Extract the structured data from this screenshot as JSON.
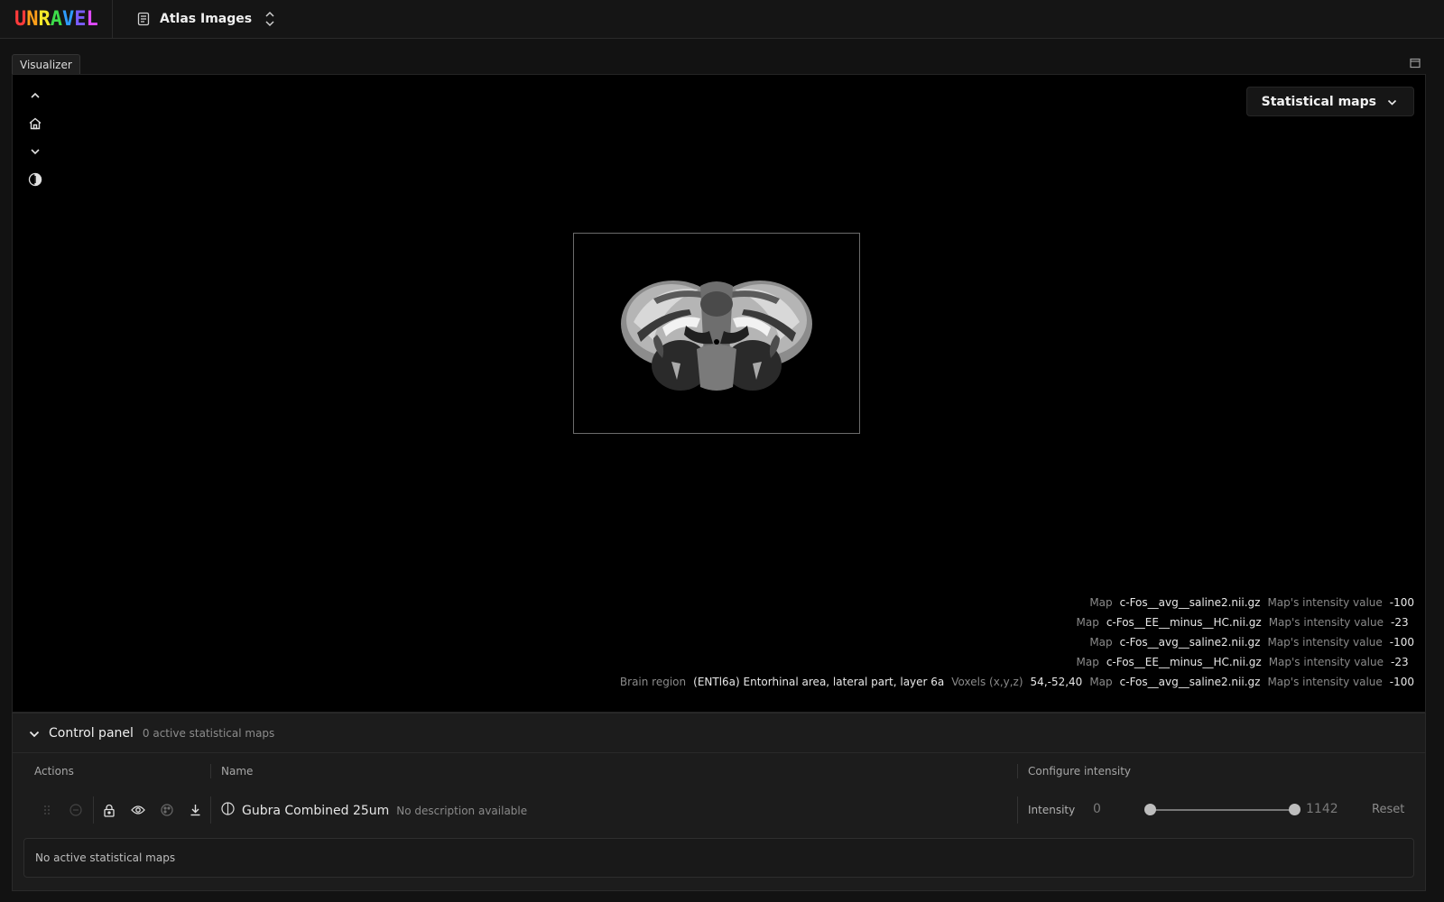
{
  "app": {
    "logo_text": "UNRAVEL",
    "logo_colors": [
      "#ff3b3b",
      "#ff9f1a",
      "#f5e82a",
      "#3ddc4a",
      "#2e9bff",
      "#7a5cff",
      "#e04bff"
    ],
    "workspace_icon": "document-icon",
    "workspace_name": "Atlas Images",
    "workspace_switch_icon": "chevron-up-down-icon"
  },
  "tabs": [
    {
      "label": "Visualizer"
    }
  ],
  "viewer": {
    "tools": [
      "chevron-up-icon",
      "home-icon",
      "chevron-down-icon",
      "contrast-icon"
    ],
    "stat_maps_label": "Statistical maps",
    "info_rows": [
      {
        "map_label": "Map",
        "map": "c-Fos__avg__saline2.nii.gz",
        "intensity_label": "Map's intensity value",
        "intensity": "-100"
      },
      {
        "map_label": "Map",
        "map": "c-Fos__EE__minus__HC.nii.gz",
        "intensity_label": "Map's intensity value",
        "intensity": "-23"
      },
      {
        "map_label": "Map",
        "map": "c-Fos__avg__saline2.nii.gz",
        "intensity_label": "Map's intensity value",
        "intensity": "-100"
      },
      {
        "map_label": "Map",
        "map": "c-Fos__EE__minus__HC.nii.gz",
        "intensity_label": "Map's intensity value",
        "intensity": "-23"
      }
    ],
    "last_row": {
      "region_label": "Brain region",
      "region": "(ENTl6a) Entorhinal area, lateral part, layer 6a",
      "voxels_label": "Voxels (x,y,z)",
      "voxels": "54,-52,40",
      "map_label": "Map",
      "map": "c-Fos__avg__saline2.nii.gz",
      "intensity_label": "Map's intensity value",
      "intensity": "-100"
    }
  },
  "control_panel": {
    "title": "Control panel",
    "subtitle": "0 active statistical maps",
    "columns": {
      "actions": "Actions",
      "name": "Name",
      "configure": "Configure intensity"
    },
    "layer": {
      "name": "Gubra Combined 25um",
      "description": "No description available",
      "intensity_label": "Intensity",
      "min": "0",
      "max": "1142",
      "reset_label": "Reset",
      "range_low_fraction": 0.0,
      "range_high_fraction": 1.0
    },
    "empty_message": "No active statistical maps"
  }
}
